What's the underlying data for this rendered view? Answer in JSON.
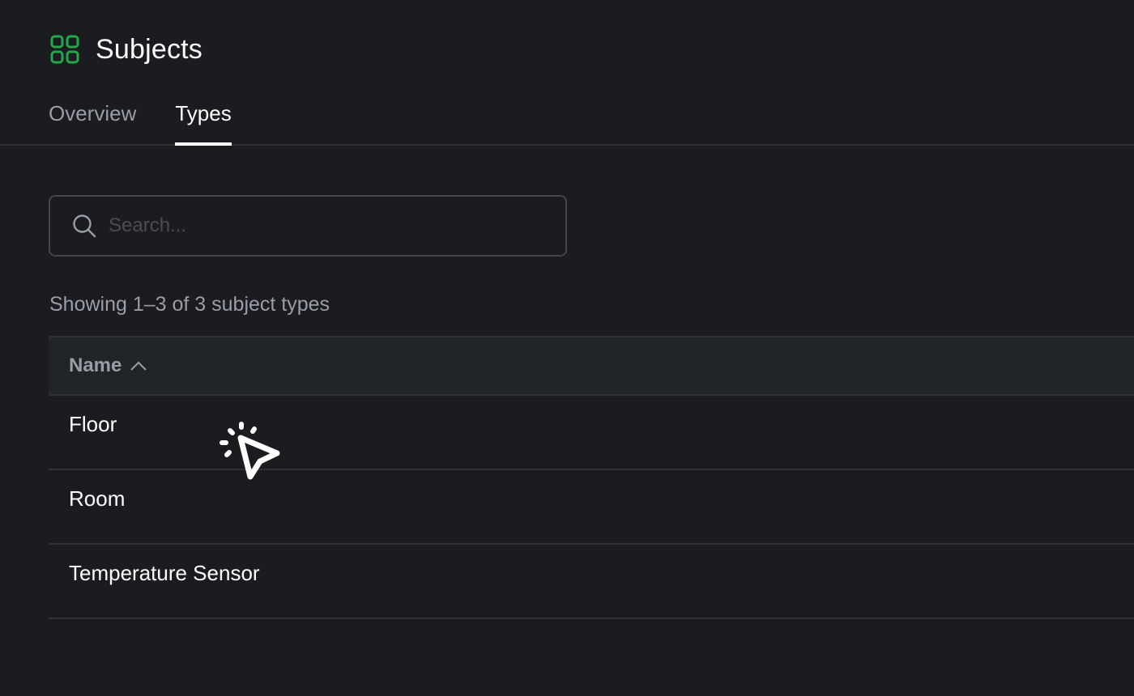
{
  "header": {
    "title": "Subjects",
    "icon": "grid-icon",
    "accent_color": "#22a84a"
  },
  "tabs": [
    {
      "label": "Overview",
      "active": false
    },
    {
      "label": "Types",
      "active": true
    }
  ],
  "search": {
    "placeholder": "Search...",
    "value": ""
  },
  "result_count": "Showing 1–3 of 3 subject types",
  "table": {
    "columns": [
      {
        "label": "Name",
        "sort": "ascending",
        "sort_icon": "chevron-up-icon"
      }
    ],
    "rows": [
      {
        "name": "Floor"
      },
      {
        "name": "Room"
      },
      {
        "name": "Temperature Sensor"
      }
    ]
  }
}
